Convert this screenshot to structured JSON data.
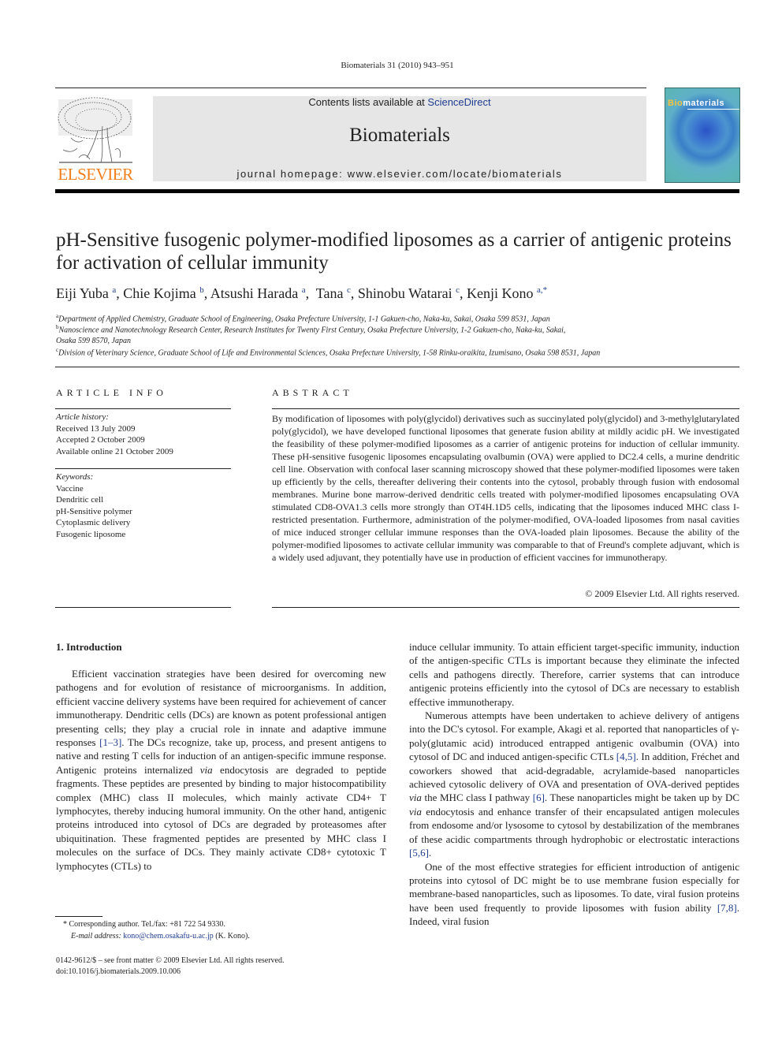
{
  "header": {
    "running_head": "Biomaterials 31 (2010) 943–951",
    "contents_prefix": "Contents lists available at ",
    "contents_link": "ScienceDirect",
    "journal_name": "Biomaterials",
    "homepage": "journal homepage: www.elsevier.com/locate/biomaterials",
    "publisher_logo_text": "ELSEVIER",
    "cover_title_accent": "Bio",
    "cover_title_rest": "materials"
  },
  "article": {
    "title": "pH-Sensitive fusogenic polymer-modified liposomes as a carrier of antigenic proteins for activation of cellular immunity",
    "authors": [
      {
        "name": "Eiji Yuba",
        "sup": "a"
      },
      {
        "name": "Chie Kojima",
        "sup": "b"
      },
      {
        "name": "Atsushi Harada",
        "sup": "a"
      },
      {
        "name": "Tana",
        "sup": "c"
      },
      {
        "name": "Shinobu Watarai",
        "sup": "c"
      },
      {
        "name": "Kenji Kono",
        "sup": "a,*"
      }
    ],
    "affiliations": [
      {
        "sup": "a",
        "text": "Department of Applied Chemistry, Graduate School of Engineering, Osaka Prefecture University, 1-1 Gakuen-cho, Naka-ku, Sakai, Osaka 599 8531, Japan"
      },
      {
        "sup": "b",
        "text": "Nanoscience and Nanotechnology Research Center, Research Institutes for Twenty First Century, Osaka Prefecture University, 1-2 Gakuen-cho, Naka-ku, Sakai,",
        "text2": "Osaka 599 8570, Japan"
      },
      {
        "sup": "c",
        "text": "Division of Veterinary Science, Graduate School of Life and Environmental Sciences, Osaka Prefecture University, 1-58 Rinku-oraikita, Izumisano, Osaka 598 8531, Japan"
      }
    ]
  },
  "article_info": {
    "heading": "ARTICLE INFO",
    "history_label": "Article history:",
    "history": [
      "Received 13 July 2009",
      "Accepted 2 October 2009",
      "Available online 21 October 2009"
    ],
    "keywords_label": "Keywords:",
    "keywords": [
      "Vaccine",
      "Dendritic cell",
      "pH-Sensitive polymer",
      "Cytoplasmic delivery",
      "Fusogenic liposome"
    ]
  },
  "abstract": {
    "heading": "ABSTRACT",
    "text": "By modification of liposomes with poly(glycidol) derivatives such as succinylated poly(glycidol) and 3-methylglutarylated poly(glycidol), we have developed functional liposomes that generate fusion ability at mildly acidic pH. We investigated the feasibility of these polymer-modified liposomes as a carrier of antigenic proteins for induction of cellular immunity. These pH-sensitive fusogenic liposomes encapsulating ovalbumin (OVA) were applied to DC2.4 cells, a murine dendritic cell line. Observation with confocal laser scanning microscopy showed that these polymer-modified liposomes were taken up efficiently by the cells, thereafter delivering their contents into the cytosol, probably through fusion with endosomal membranes. Murine bone marrow-derived dendritic cells treated with polymer-modified liposomes encapsulating OVA stimulated CD8-OVA1.3 cells more strongly than OT4H.1D5 cells, indicating that the liposomes induced MHC class I-restricted presentation. Furthermore, administration of the polymer-modified, OVA-loaded liposomes from nasal cavities of mice induced stronger cellular immune responses than the OVA-loaded plain liposomes. Because the ability of the polymer-modified liposomes to activate cellular immunity was comparable to that of Freund's complete adjuvant, which is a widely used adjuvant, they potentially have use in production of efficient vaccines for immunotherapy.",
    "copyright": "© 2009 Elsevier Ltd. All rights reserved."
  },
  "body": {
    "intro_heading": "1.  Introduction",
    "left_p1_a": "Efficient vaccination strategies have been desired for overcoming new pathogens and for evolution of resistance of microorganisms. In addition, efficient vaccine delivery systems have been required for achievement of cancer immunotherapy. Dendritic cells (DCs) are known as potent professional antigen presenting cells; they play a crucial role in innate and adaptive immune responses ",
    "left_p1_ref1": "[1–3]",
    "left_p1_b": ". The DCs recognize, take up, process, and present antigens to native and resting T cells for induction of an antigen-specific immune response. Antigenic proteins internalized ",
    "left_p1_via": "via",
    "left_p1_c": " endocytosis are degraded to peptide fragments. These peptides are presented by binding to major histocompatibility complex (MHC) class II molecules, which mainly activate CD4+ T lymphocytes, thereby inducing humoral immunity. On the other hand, antigenic proteins introduced into cytosol of DCs are degraded by proteasomes after ubiquitination. These fragmented peptides are presented by MHC class I molecules on the surface of DCs. They mainly activate CD8+ cytotoxic T lymphocytes (CTLs) to",
    "right_p1": "induce cellular immunity. To attain efficient target-specific immunity, induction of the antigen-specific CTLs is important because they eliminate the infected cells and pathogens directly. Therefore, carrier systems that can introduce antigenic proteins efficiently into the cytosol of DCs are necessary to establish effective immunotherapy.",
    "right_p2_a": "Numerous attempts have been undertaken to achieve delivery of antigens into the DC's cytosol. For example, Akagi et al. reported that nanoparticles of γ-poly(glutamic acid) introduced entrapped antigenic ovalbumin (OVA) into cytosol of DC and induced antigen-specific CTLs ",
    "right_p2_ref1": "[4,5]",
    "right_p2_b": ". In addition, Fréchet and coworkers showed that acid-degradable, acrylamide-based nanoparticles achieved cytosolic delivery of OVA and presentation of OVA-derived peptides ",
    "right_p2_via1": "via",
    "right_p2_c": " the MHC class I pathway ",
    "right_p2_ref2": "[6]",
    "right_p2_d": ". These nanoparticles might be taken up by DC ",
    "right_p2_via2": "via",
    "right_p2_e": " endocytosis and enhance transfer of their encapsulated antigen molecules from endosome and/or lysosome to cytosol by destabilization of the membranes of these acidic compartments through hydrophobic or electrostatic interactions ",
    "right_p2_ref3": "[5,6]",
    "right_p2_f": ".",
    "right_p3_a": "One of the most effective strategies for efficient introduction of antigenic proteins into cytosol of DC might be to use membrane fusion especially for membrane-based nanoparticles, such as liposomes. To date, viral fusion proteins have been used frequently to provide liposomes with fusion ability ",
    "right_p3_ref1": "[7,8]",
    "right_p3_b": ". Indeed, viral fusion"
  },
  "footnotes": {
    "corresponding": "*  Corresponding author. Tel./fax: +81 722 54 9330.",
    "email_label": "E-mail address: ",
    "email": "kono@chem.osakafu-u.ac.jp",
    "email_suffix": " (K. Kono).",
    "issn": "0142-9612/$ – see front matter © 2009 Elsevier Ltd. All rights reserved.",
    "doi": "doi:10.1016/j.biomaterials.2009.10.006"
  }
}
